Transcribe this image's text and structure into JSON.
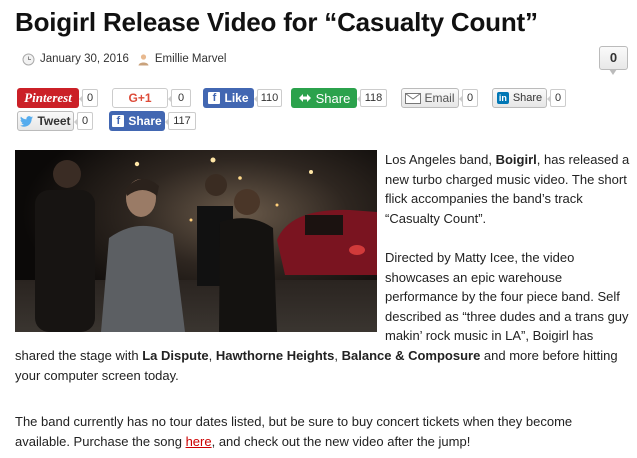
{
  "article": {
    "title": "Boigirl Release Video for “Casualty Count”",
    "date": "January 30, 2016",
    "author": "Emillie Marvel",
    "comment_count": "0"
  },
  "share": {
    "pinterest": {
      "label": "Pinterest",
      "count": "0",
      "color": "#cb2027"
    },
    "gplus": {
      "label": "G+1",
      "count": "0",
      "color": "#dd4b39"
    },
    "fb_like": {
      "icon": "f",
      "label": "Like",
      "count": "110",
      "color": "#4267b2"
    },
    "share": {
      "label": "Share",
      "count": "118",
      "color": "#2ba24c"
    },
    "email": {
      "label": "Email",
      "count": "0"
    },
    "linkedin": {
      "icon": "in",
      "label": "Share",
      "count": "0",
      "color": "#0077b5"
    },
    "tweet": {
      "label": "Tweet",
      "count": "0"
    },
    "fb_share": {
      "icon": "f",
      "label": "Share",
      "count": "117",
      "color": "#4267b2"
    }
  },
  "body": {
    "p1_pre": "Los Angeles band, ",
    "p1_band": "Boigirl",
    "p1_post": ", has released a new turbo charged music video. The short flick accompanies the band’s track “Casualty Count”.",
    "p2_a": "Directed by Matty Icee, the video showcases an epic warehouse performance by the four piece band. Self described as “three dudes and a trans guy makin’ rock music in LA”, Boigirl has",
    "p2_b": "shared the stage with ",
    "band1": "La Dispute",
    "sep1": ", ",
    "band2": "Hawthorne Heights",
    "sep2": ", ",
    "band3": "Balance & Composure",
    "p2_c": " and more before hitting your computer screen today.",
    "p3_a": "The band currently has no tour dates listed, but be sure to buy concert tickets when they become available. Purchase the song ",
    "p3_link": "here",
    "p3_b": ", and check out the new video after the jump!"
  }
}
